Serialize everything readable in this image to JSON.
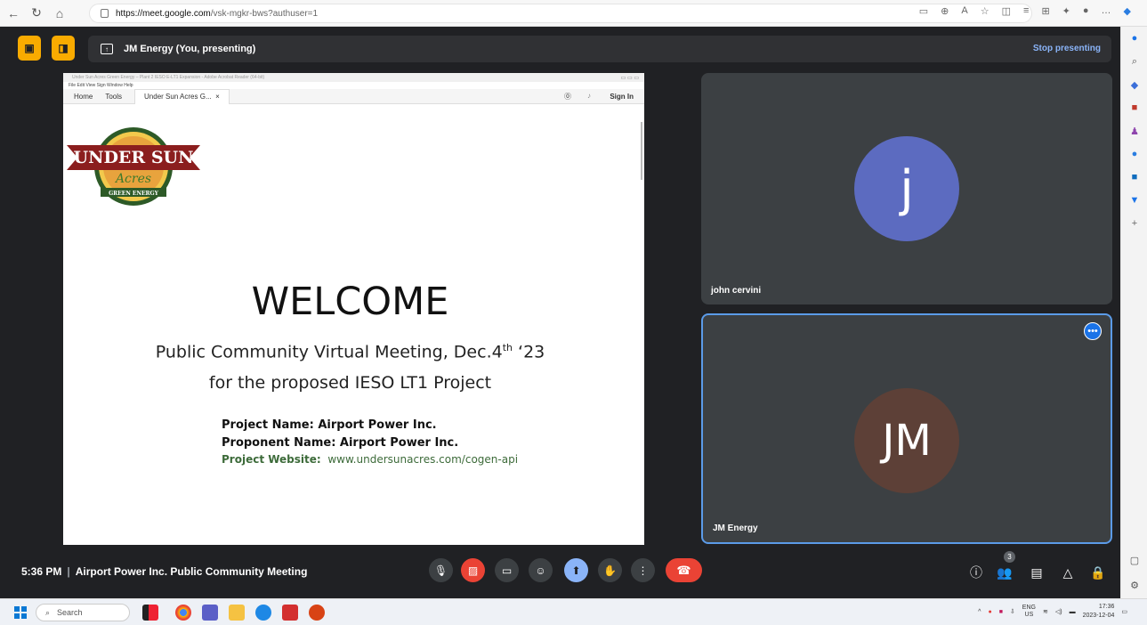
{
  "browser": {
    "url_host": "https://meet.google.com",
    "url_path": "/vsk-mgkr-bws?authuser=1"
  },
  "presenting": {
    "label": "JM Energy (You, presenting)",
    "stop_label": "Stop presenting"
  },
  "shared_screen": {
    "window_title": "Under Sun Acres Green Energy – Plant 2 IESO E-LT1 Expansion - Adobe Acrobat Reader (64-bit)",
    "menu": [
      "File",
      "Edit",
      "View",
      "Sign",
      "Window",
      "Help"
    ],
    "tabs": {
      "home": "Home",
      "tools": "Tools",
      "doc": "Under Sun Acres G...",
      "close": "×",
      "sign_in": "Sign In"
    },
    "logo": {
      "line1": "UNDER SUN",
      "line2": "Acres",
      "line3": "GREEN ENERGY"
    },
    "slide": {
      "heading": "WELCOME",
      "subtitle_a": "Public Community Virtual Meeting, Dec.4",
      "subtitle_sup": "th",
      "subtitle_b": " ‘23",
      "subtitle2": "for the proposed IESO LT1 Project",
      "project_name": "Project Name: Airport Power Inc.",
      "proponent_name": "Proponent Name: Airport Power Inc.",
      "website_label": "Project Website:",
      "website_value": "www.undersunacres.com/cogen-api"
    }
  },
  "participants": [
    {
      "name": "john cervini",
      "initials": "j",
      "color": "#5c6bc0"
    },
    {
      "name": "JM Energy",
      "initials": "JM",
      "color": "#5d4037"
    }
  ],
  "bottom": {
    "time": "5:36 PM",
    "sep": "|",
    "meeting_title": "Airport Power Inc. Public Community Meeting",
    "participant_count": "3"
  },
  "taskbar": {
    "search_placeholder": "Search",
    "lang_top": "ENG",
    "lang_bottom": "US",
    "clock_time": "17:36",
    "clock_date": "2023-12-04"
  }
}
